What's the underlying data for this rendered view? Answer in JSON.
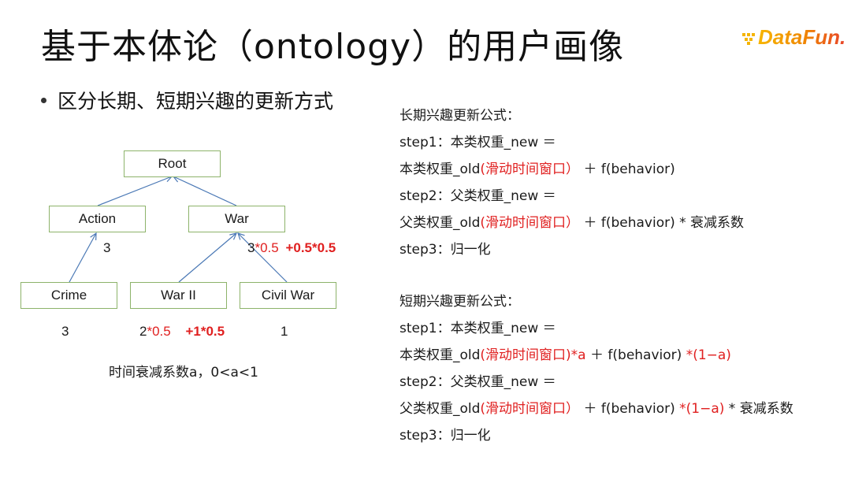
{
  "title": "基于本体论（ontology）的用户画像",
  "logo": {
    "text": "DataFun.",
    "icon": "datafun-dots-logo"
  },
  "bullet": "区分长期、短期兴趣的更新方式",
  "tree": {
    "nodes": {
      "root": "Root",
      "action": "Action",
      "war": "War",
      "crime": "Crime",
      "war2": "War II",
      "civil_war": "Civil War"
    },
    "edges": [
      [
        "action",
        "root"
      ],
      [
        "war",
        "root"
      ],
      [
        "crime",
        "action"
      ],
      [
        "war2",
        "war"
      ],
      [
        "civil_war",
        "war"
      ]
    ],
    "labels": {
      "action_weight": "3",
      "war_weight_base": "3",
      "war_weight_mul": "*0.5",
      "war_weight_add": "+0.5*0.5",
      "crime_weight": "3",
      "war2_weight_base": "2",
      "war2_weight_mul": "*0.5",
      "war2_weight_add": "+1*0.5",
      "civil_war_weight": "1"
    },
    "caption": "时间衰减系数a，0<a<1"
  },
  "long_term": {
    "heading": "长期兴趣更新公式：",
    "step1_label": "step1：本类权重_new ＝",
    "step1_a": "本类权重_old",
    "step1_b": "(滑动时间窗口）",
    "step1_c": " ＋ f(behavior)",
    "step2_label": "step2：父类权重_new ＝",
    "step2_a": "父类权重_old",
    "step2_b": "(滑动时间窗口）",
    "step2_c": " ＋ f(behavior) * 衰减系数",
    "step3": "step3：归一化"
  },
  "short_term": {
    "heading": "短期兴趣更新公式：",
    "step1_label": "step1：本类权重_new ＝",
    "step1_a": "本类权重_old",
    "step1_b": "(滑动时间窗口)*a",
    "step1_c": " ＋ f(behavior) ",
    "step1_d": "*(1−a)",
    "step2_label": "step2：父类权重_new ＝",
    "step2_a": "父类权重_old",
    "step2_b": "(滑动时间窗口）",
    "step2_c": " ＋ f(behavior) ",
    "step2_d": "*(1−a)",
    "step2_e": " * 衰减系数",
    "step3": "step3：归一化"
  },
  "colors": {
    "accent_red": "#e02020",
    "node_border": "#8db36a",
    "edge": "#4a78b5"
  }
}
